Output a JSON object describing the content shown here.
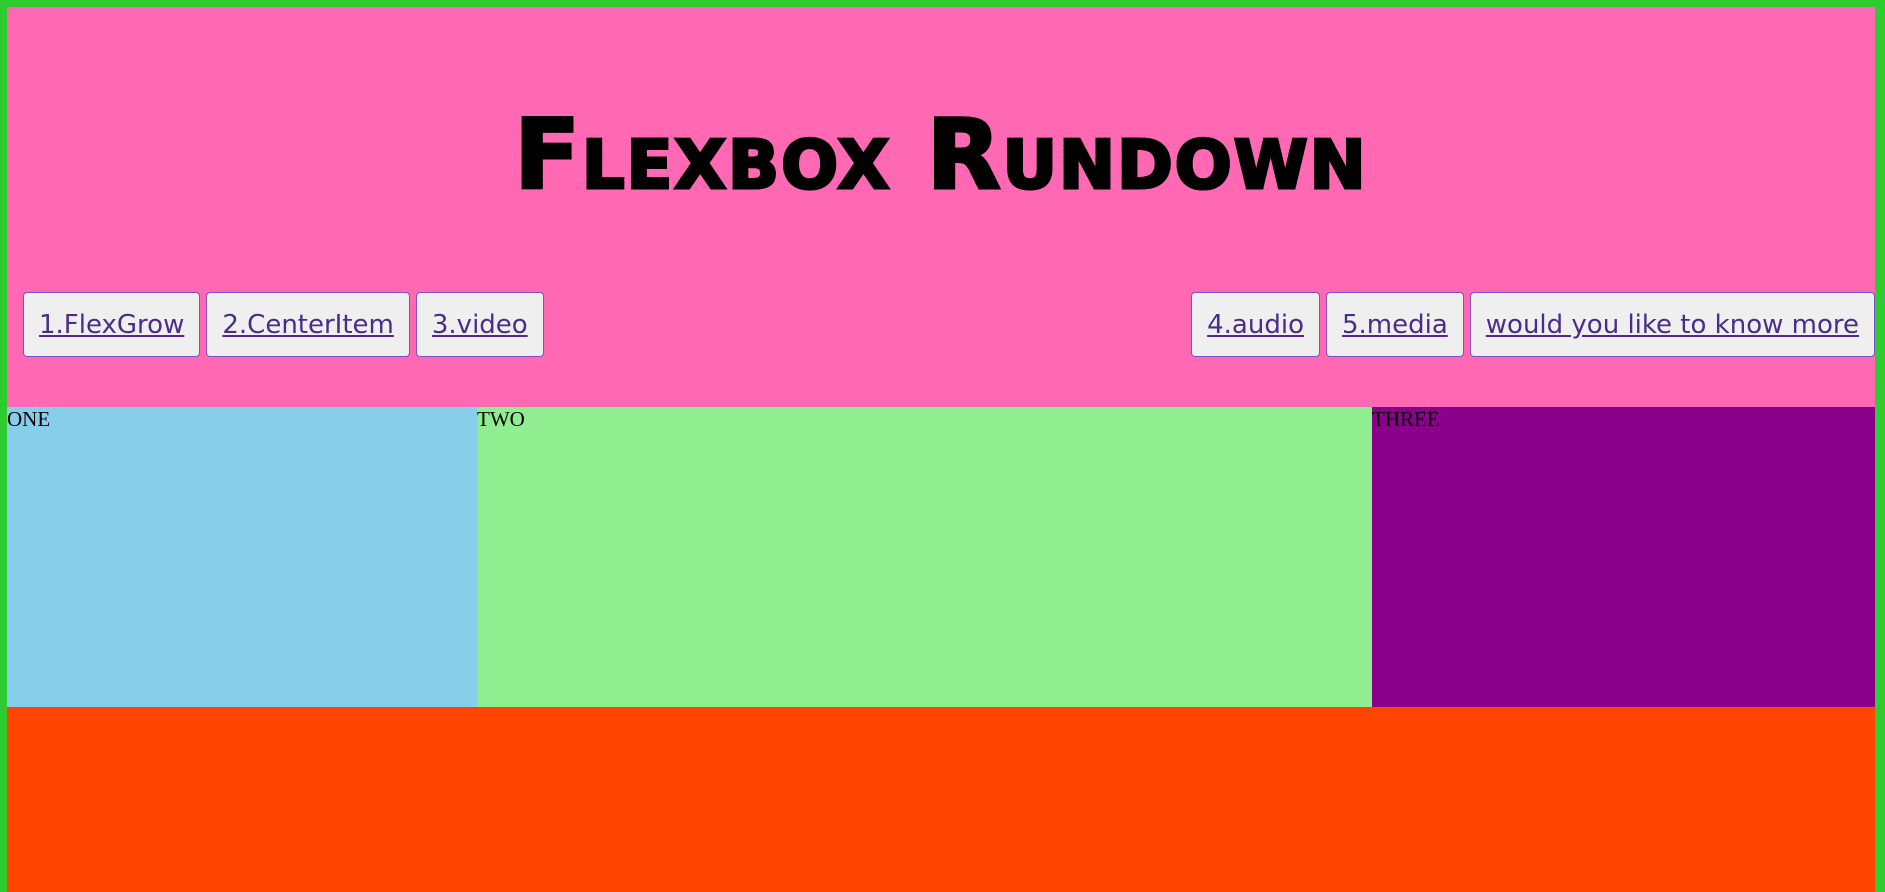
{
  "header": {
    "title": "Flexbox Rundown"
  },
  "nav": {
    "left": [
      {
        "label": "1.FlexGrow"
      },
      {
        "label": "2.CenterItem"
      },
      {
        "label": "3.video"
      }
    ],
    "right": [
      {
        "label": "4.audio"
      },
      {
        "label": "5.media"
      },
      {
        "label": "would you like to know more"
      }
    ]
  },
  "boxes": {
    "one": "ONE",
    "two": "TWO",
    "three": "THREE"
  },
  "colors": {
    "border": "#2ecc2e",
    "header_bg": "#ff69b4",
    "box_one": "#87ceeb",
    "box_two": "#90ee90",
    "box_three": "#8b008b",
    "footer": "#ff4500"
  }
}
